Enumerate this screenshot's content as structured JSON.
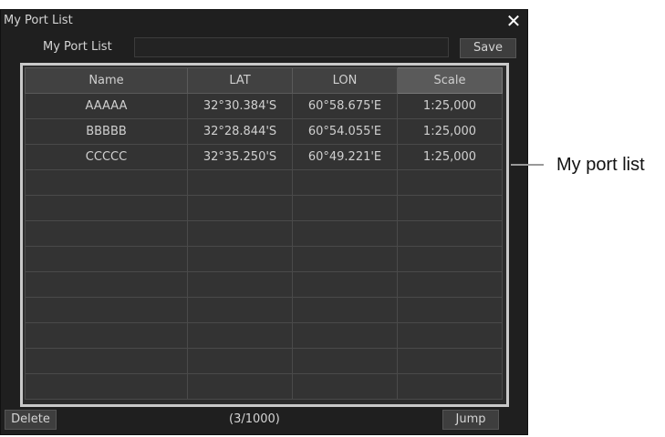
{
  "window": {
    "title": "My Port List",
    "close_glyph": "✕"
  },
  "form": {
    "name_label": "My Port List",
    "name_value": "",
    "save_label": "Save"
  },
  "table": {
    "headers": {
      "name": "Name",
      "lat": "LAT",
      "lon": "LON",
      "scale": "Scale"
    },
    "rows": [
      {
        "name": "AAAAA",
        "lat": "32°30.384'S",
        "lon": "60°58.675'E",
        "scale": "1:25,000"
      },
      {
        "name": "BBBBB",
        "lat": "32°28.844'S",
        "lon": "60°54.055'E",
        "scale": "1:25,000"
      },
      {
        "name": "CCCCC",
        "lat": "32°35.250'S",
        "lon": "60°49.221'E",
        "scale": "1:25,000"
      },
      {
        "name": "",
        "lat": "",
        "lon": "",
        "scale": ""
      },
      {
        "name": "",
        "lat": "",
        "lon": "",
        "scale": ""
      },
      {
        "name": "",
        "lat": "",
        "lon": "",
        "scale": ""
      },
      {
        "name": "",
        "lat": "",
        "lon": "",
        "scale": ""
      },
      {
        "name": "",
        "lat": "",
        "lon": "",
        "scale": ""
      },
      {
        "name": "",
        "lat": "",
        "lon": "",
        "scale": ""
      },
      {
        "name": "",
        "lat": "",
        "lon": "",
        "scale": ""
      },
      {
        "name": "",
        "lat": "",
        "lon": "",
        "scale": ""
      },
      {
        "name": "",
        "lat": "",
        "lon": "",
        "scale": ""
      }
    ]
  },
  "footer": {
    "delete_label": "Delete",
    "counter": "(3/1000)",
    "jump_label": "Jump"
  },
  "callout": {
    "label": "My port list"
  }
}
